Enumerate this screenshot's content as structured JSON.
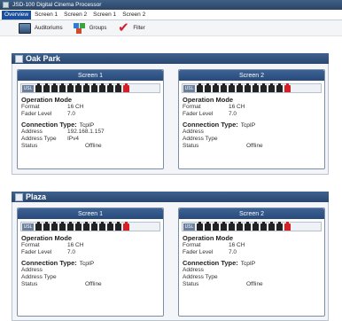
{
  "window": {
    "title": "JSD-100 Digital Cinema Processor"
  },
  "tabs": [
    {
      "label": "Overview",
      "active": true
    },
    {
      "label": "Screen 1",
      "active": false
    },
    {
      "label": "Screen 2",
      "active": false
    },
    {
      "label": "Screen 1",
      "active": false
    },
    {
      "label": "Screen 2",
      "active": false
    }
  ],
  "toolbar": {
    "auditoriums": "Auditoriums",
    "groups": "Groups",
    "filter": "Filter"
  },
  "labels": {
    "operation_mode": "Operation Mode",
    "format": "Format",
    "fader_level": "Fader Level",
    "connection_type": "Connection Type:",
    "address": "Address",
    "address_type": "Address Type",
    "status": "Status",
    "channel_tag": "USL"
  },
  "colors": {
    "header_blue": "#2a4770",
    "active_tab": "#1b4f9b",
    "alert_red": "#d41f24"
  },
  "groups": [
    {
      "name": "Oak Park",
      "screens": [
        {
          "title": "Screen 1",
          "format": "16 CH",
          "fader": "7.0",
          "connection": "TcpIP",
          "address": "192.168.1.157",
          "address_type": "IPv4",
          "status": "Offline"
        },
        {
          "title": "Screen 2",
          "format": "16 CH",
          "fader": "7.0",
          "connection": "TcpIP",
          "address": "",
          "address_type": "",
          "status": "Offline"
        }
      ]
    },
    {
      "name": "Plaza",
      "screens": [
        {
          "title": "Screen 1",
          "format": "16 CH",
          "fader": "7.0",
          "connection": "TcpIP",
          "address": "",
          "address_type": "",
          "status": "Offline"
        },
        {
          "title": "Screen 2",
          "format": "16 CH",
          "fader": "7.0",
          "connection": "TcpIP",
          "address": "",
          "address_type": "",
          "status": "Offline"
        }
      ]
    }
  ]
}
